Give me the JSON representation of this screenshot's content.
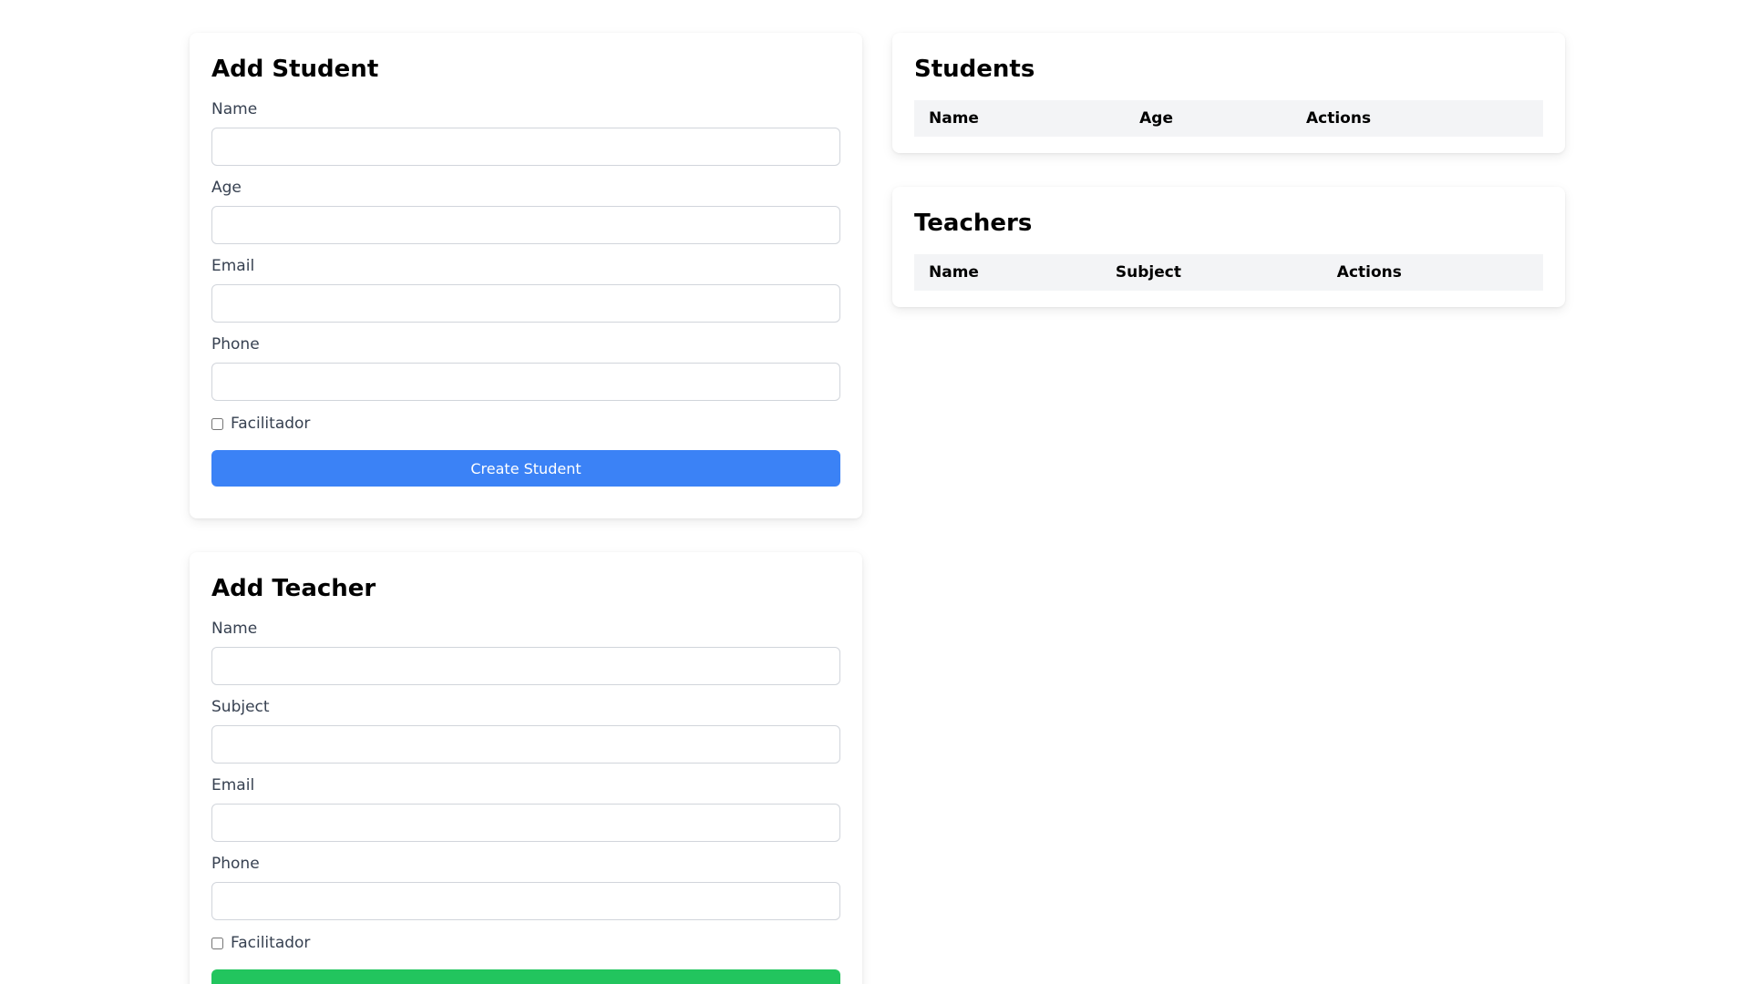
{
  "add_student": {
    "title": "Add Student",
    "fields": [
      {
        "label": "Name",
        "value": "",
        "placeholder": ""
      },
      {
        "label": "Age",
        "value": "",
        "placeholder": ""
      },
      {
        "label": "Email",
        "value": "",
        "placeholder": ""
      },
      {
        "label": "Phone",
        "value": "",
        "placeholder": ""
      }
    ],
    "checkbox_label": "Facilitador",
    "submit_label": "Create Student",
    "submit_color": "#3b82f6"
  },
  "add_teacher": {
    "title": "Add Teacher",
    "fields": [
      {
        "label": "Name",
        "value": "",
        "placeholder": ""
      },
      {
        "label": "Subject",
        "value": "",
        "placeholder": ""
      },
      {
        "label": "Email",
        "value": "",
        "placeholder": ""
      },
      {
        "label": "Phone",
        "value": "",
        "placeholder": ""
      }
    ],
    "checkbox_label": "Facilitador",
    "submit_color": "#22c55e"
  },
  "students_table": {
    "title": "Students",
    "columns": [
      "Name",
      "Age",
      "Actions"
    ],
    "rows": []
  },
  "teachers_table": {
    "title": "Teachers",
    "columns": [
      "Name",
      "Subject",
      "Actions"
    ],
    "rows": []
  }
}
